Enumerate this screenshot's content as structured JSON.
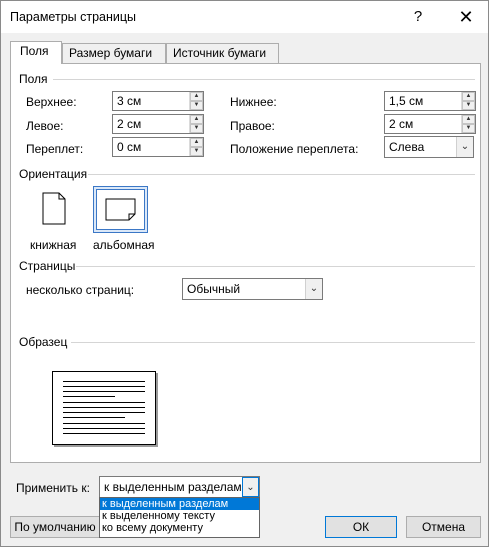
{
  "window": {
    "title": "Параметры страницы",
    "help": "?",
    "close": "✕"
  },
  "tabs": [
    {
      "label": "Поля"
    },
    {
      "label": "Размер бумаги"
    },
    {
      "label": "Источник бумаги"
    }
  ],
  "margins": {
    "section": "Поля",
    "top_label": "Верхнее:",
    "top_value": "3 см",
    "left_label": "Левое:",
    "left_value": "2 см",
    "gutter_label": "Переплет:",
    "gutter_value": "0 см",
    "bottom_label": "Нижнее:",
    "bottom_value": "1,5 см",
    "right_label": "Правое:",
    "right_value": "2 см",
    "gutter_pos_label": "Положение переплета:",
    "gutter_pos_value": "Слева"
  },
  "orientation": {
    "section": "Ориентация",
    "portrait": "книжная",
    "landscape": "альбомная",
    "selected": "landscape"
  },
  "pages": {
    "section": "Страницы",
    "multiple_label": "несколько страниц:",
    "multiple_value": "Обычный"
  },
  "preview": {
    "section": "Образец"
  },
  "apply": {
    "label": "Применить к:",
    "value": "к выделенным разделам",
    "options": [
      "к выделенным разделам",
      "к выделенному тексту",
      "ко всему документу"
    ],
    "selected_index": 0
  },
  "buttons": {
    "default": "По умолчанию",
    "ok": "ОК",
    "cancel": "Отмена"
  },
  "colors": {
    "accent": "#0078d7",
    "selection_border": "#3b77c6"
  }
}
